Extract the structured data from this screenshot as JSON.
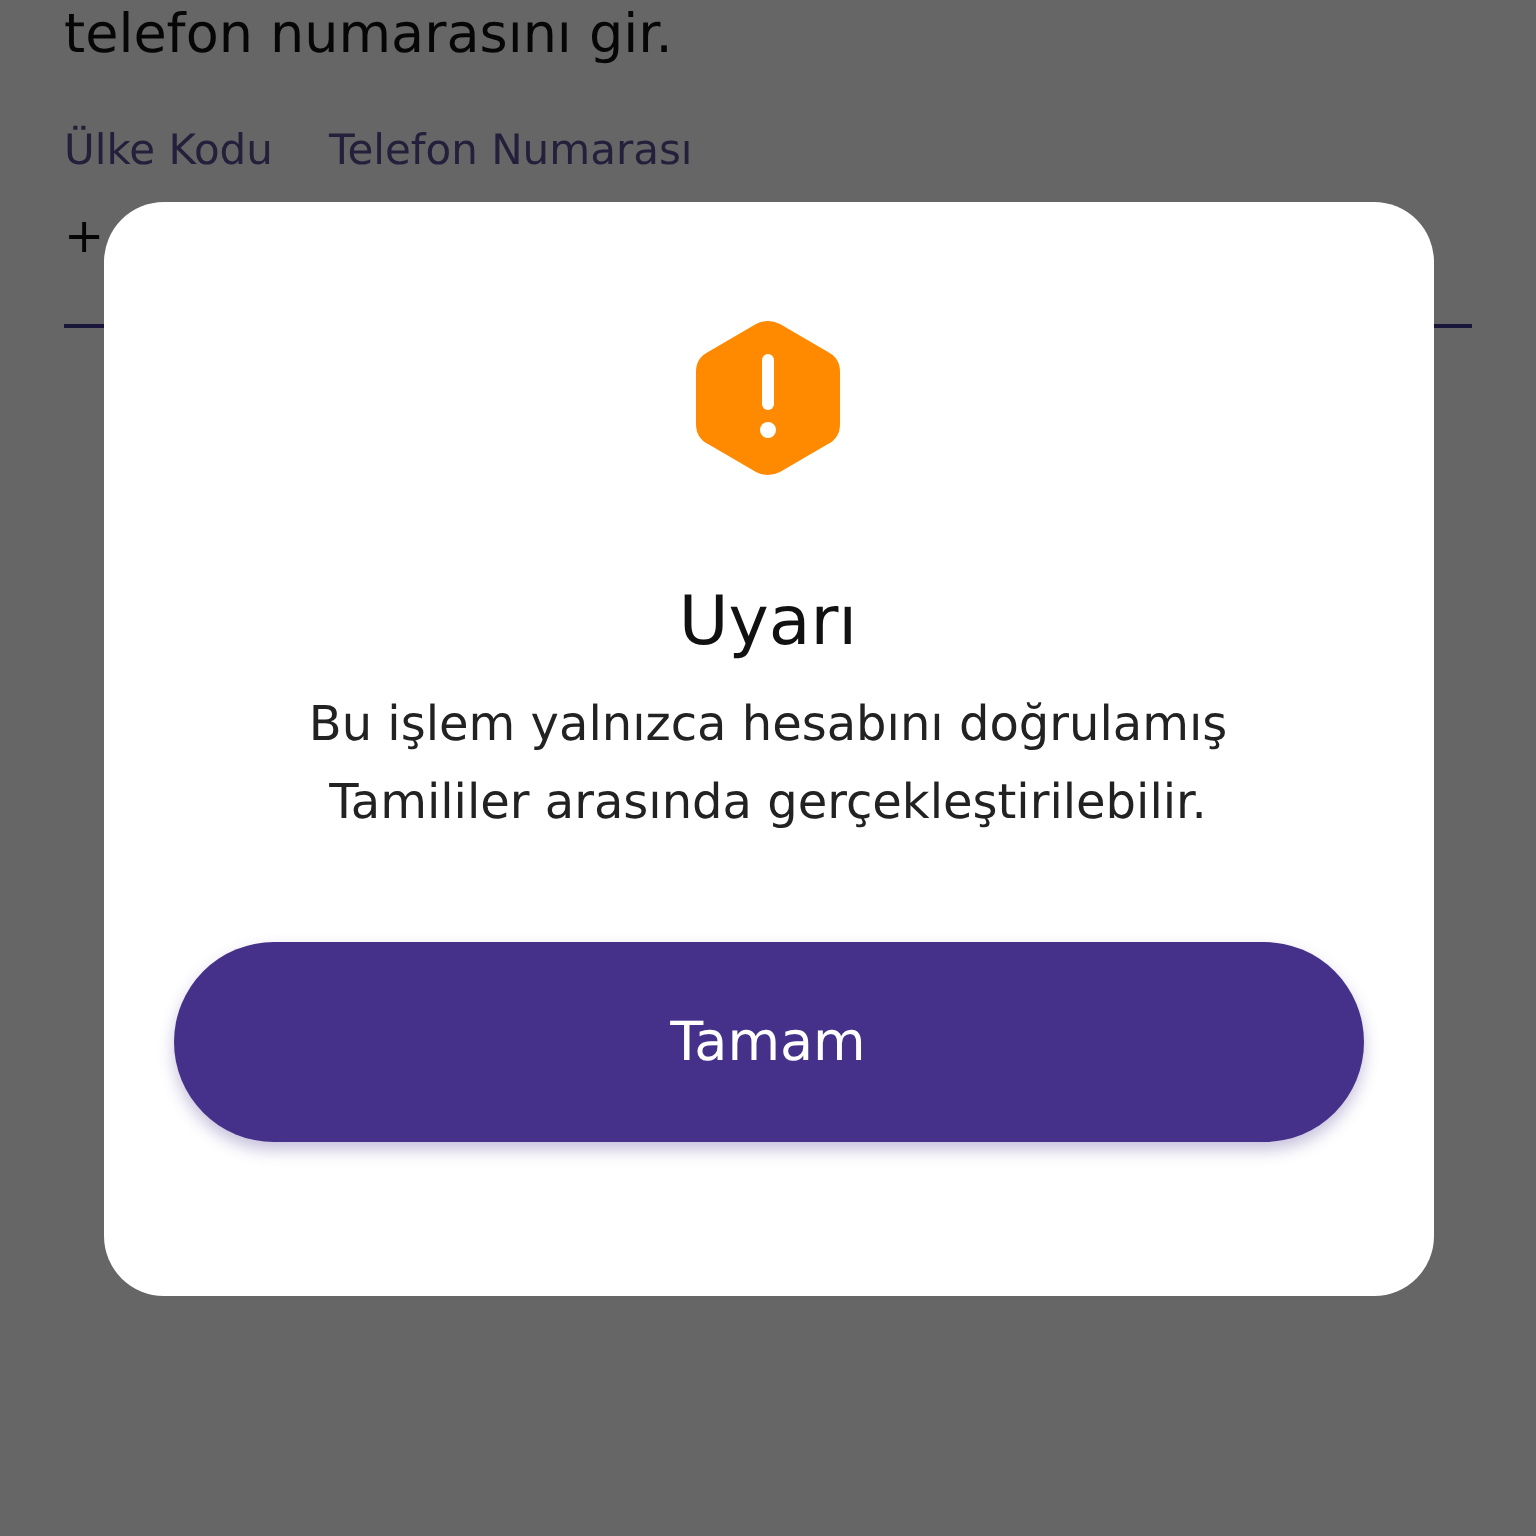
{
  "page": {
    "heading": "telefon numarasını gir.",
    "country_code_label": "Ülke Kodu",
    "phone_label": "Telefon Numarası",
    "country_code_value": "+"
  },
  "dialog": {
    "title": "Uyarı",
    "message": "Bu işlem yalnızca hesabını doğrulamış Tamililer arasında gerçekleştirilebilir.",
    "button": "Tamam"
  }
}
